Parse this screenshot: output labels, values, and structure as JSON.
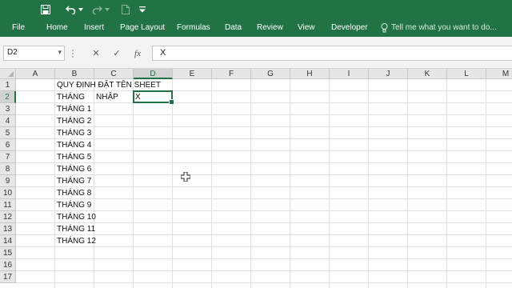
{
  "quick_access": {
    "icons": [
      "save-icon",
      "undo-icon",
      "undo-dropdown-icon",
      "redo-icon",
      "redo-dropdown-icon",
      "new-document-icon",
      "customize-dropdown-icon"
    ]
  },
  "ribbon": {
    "tabs": [
      {
        "label": "File"
      },
      {
        "label": "Home"
      },
      {
        "label": "Insert"
      },
      {
        "label": "Page Layout"
      },
      {
        "label": "Formulas"
      },
      {
        "label": "Data"
      },
      {
        "label": "Review"
      },
      {
        "label": "View"
      },
      {
        "label": "Developer"
      }
    ],
    "tell_me": "Tell me what you want to do..."
  },
  "formula_bar": {
    "name_box": "D2",
    "cancel_symbol": "✕",
    "enter_symbol": "✓",
    "function_symbol": "fx",
    "value": "X"
  },
  "sheet": {
    "columns": [
      "A",
      "B",
      "C",
      "D",
      "E",
      "F",
      "G",
      "H",
      "I",
      "J",
      "K",
      "L",
      "M"
    ],
    "rows": [
      "1",
      "2",
      "3",
      "4",
      "5",
      "6",
      "7",
      "8",
      "9",
      "10",
      "11",
      "12",
      "13",
      "14",
      "15",
      "16",
      "17"
    ],
    "selected_cell": "D2",
    "cells": {
      "B1": "QUY ĐỊNH ĐẶT TÊN SHEET",
      "B2": "THÁNG",
      "C2": "NHẬP",
      "D2": "X",
      "B3": "THÁNG 1",
      "B4": "THÁNG 2",
      "B5": "THÁNG 3",
      "B6": "THÁNG 4",
      "B7": "THÁNG 5",
      "B8": "THÁNG 6",
      "B9": "THÁNG 7",
      "B10": "THÁNG 8",
      "B11": "THÁNG 9",
      "B12": "THÁNG 10",
      "B13": "THÁNG 11",
      "B14": "THÁNG 12"
    }
  },
  "colors": {
    "accent": "#217346",
    "gridline": "#e1e1e1",
    "header_bg": "#e6e6e6"
  }
}
